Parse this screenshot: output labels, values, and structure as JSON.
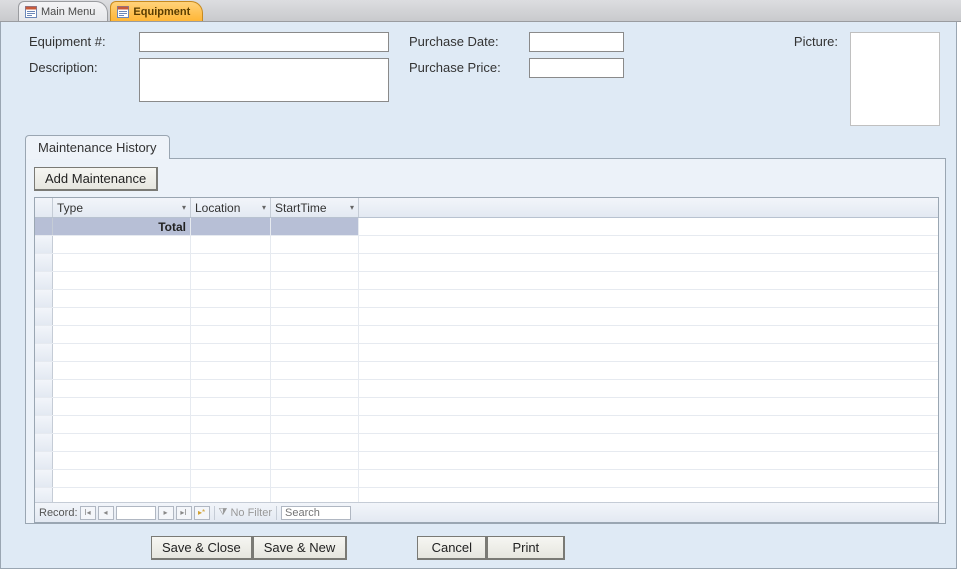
{
  "tabs": {
    "mainmenu": "Main Menu",
    "equipment": "Equipment"
  },
  "fields": {
    "equipment_num_label": "Equipment #:",
    "equipment_num_value": "",
    "description_label": "Description:",
    "description_value": "",
    "purchase_date_label": "Purchase Date:",
    "purchase_date_value": "",
    "purchase_price_label": "Purchase Price:",
    "purchase_price_value": "",
    "picture_label": "Picture:"
  },
  "subform": {
    "tab_label": "Maintenance History",
    "add_button": "Add Maintenance",
    "columns": {
      "type": "Type",
      "location": "Location",
      "starttime": "StartTime"
    },
    "total_label": "Total",
    "recnav": {
      "label": "Record:",
      "nofilter": "No Filter",
      "search_placeholder": "Search"
    }
  },
  "buttons": {
    "save_close": "Save & Close",
    "save_new": "Save & New",
    "cancel": "Cancel",
    "print": "Print"
  },
  "colors": {
    "canvas_bg": "#dfeaf5",
    "active_tab": "#ffb636"
  }
}
